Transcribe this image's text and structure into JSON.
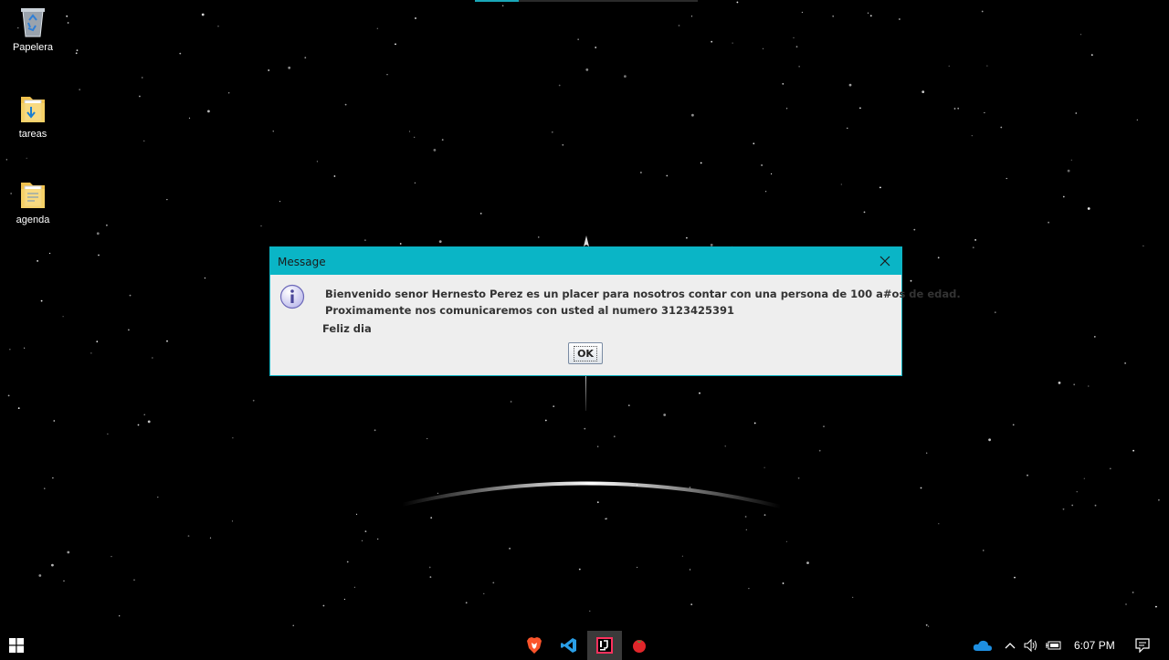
{
  "desktop": {
    "icons": [
      {
        "label": "Papelera",
        "icon": "recycle-bin-icon"
      },
      {
        "label": "tareas",
        "icon": "folder-icon"
      },
      {
        "label": "agenda",
        "icon": "folder-icon"
      }
    ]
  },
  "dialog": {
    "title": "Message",
    "line1": "Bienvenido senor Hernesto Perez es un placer para nosotros contar con una persona de 100 a#os de edad.",
    "line2": "Proximamente nos comunicaremos con usted al numero 3123425391",
    "line3": "Feliz dia",
    "ok_label": "OK",
    "accent": "#0ab5c6"
  },
  "taskbar": {
    "apps": [
      {
        "name": "brave-browser-icon"
      },
      {
        "name": "vscode-icon"
      },
      {
        "name": "intellij-idea-icon",
        "active": true
      },
      {
        "name": "tomato-timer-icon"
      }
    ],
    "tray": {
      "time": "6:07 PM"
    }
  }
}
